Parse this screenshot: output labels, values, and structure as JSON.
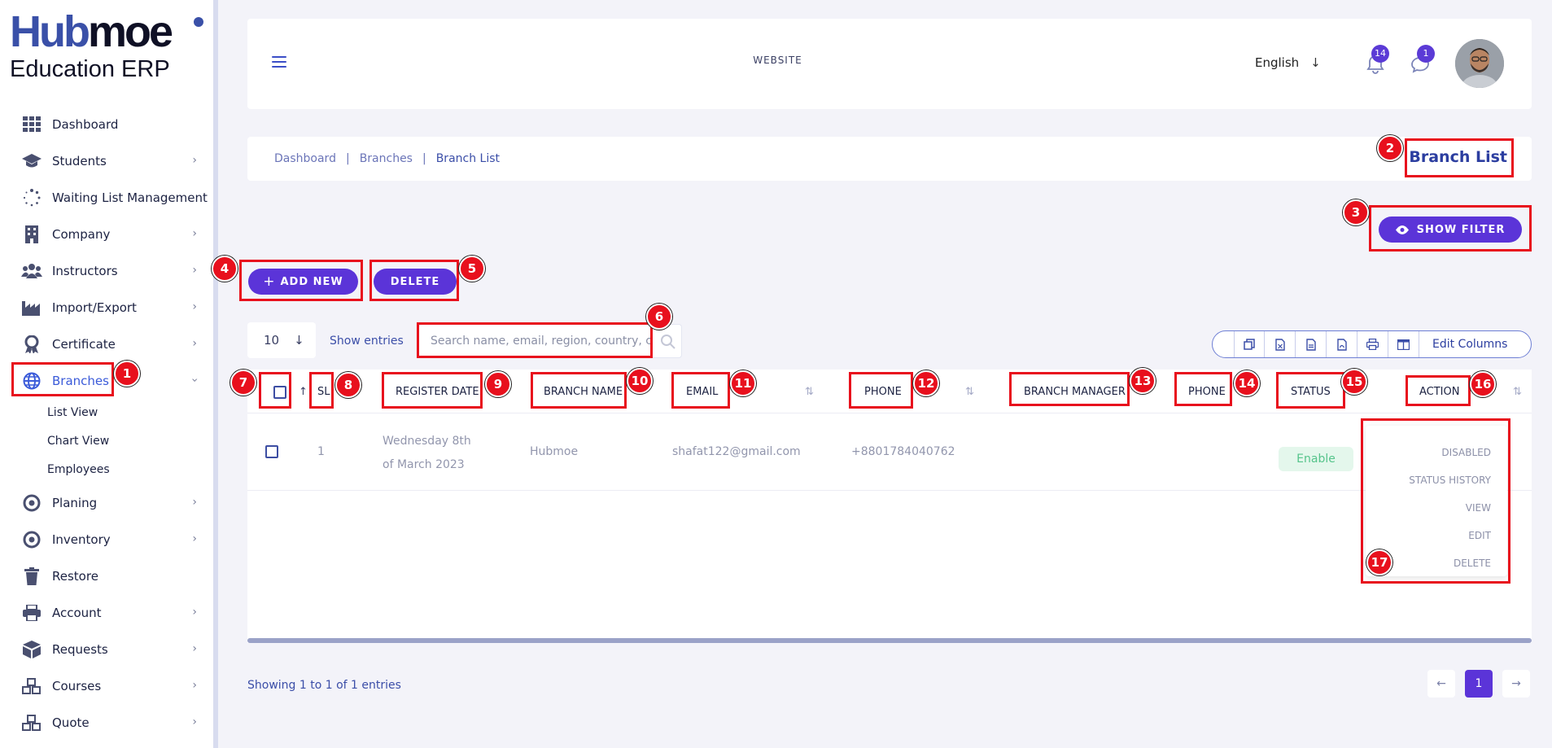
{
  "brand": {
    "logo_hub": "Hub",
    "logo_moe": "moe",
    "logo_sub": "Education ERP"
  },
  "sidebar": {
    "items": [
      {
        "label": "Dashboard",
        "icon": "grid-icon"
      },
      {
        "label": "Students",
        "icon": "graduation-cap-icon"
      },
      {
        "label": "Waiting List Management",
        "icon": "spinner-icon"
      },
      {
        "label": "Company",
        "icon": "building-icon"
      },
      {
        "label": "Instructors",
        "icon": "users-icon"
      },
      {
        "label": "Import/Export",
        "icon": "factory-icon"
      },
      {
        "label": "Certificate",
        "icon": "award-icon"
      },
      {
        "label": "Branches",
        "icon": "globe-icon"
      },
      {
        "label": "Planing",
        "icon": "target-icon"
      },
      {
        "label": "Inventory",
        "icon": "target-icon"
      },
      {
        "label": "Restore",
        "icon": "trash-icon"
      },
      {
        "label": "Account",
        "icon": "printer-icon"
      },
      {
        "label": "Requests",
        "icon": "box-icon"
      },
      {
        "label": "Courses",
        "icon": "cubes-icon"
      },
      {
        "label": "Quote",
        "icon": "cubes-icon"
      }
    ],
    "branches_sub": [
      "List View",
      "Chart View",
      "Employees"
    ]
  },
  "header": {
    "title": "WEBSITE",
    "language": "English",
    "notifications_count": "14",
    "messages_count": "1"
  },
  "breadcrumb": {
    "items": [
      "Dashboard",
      "Branches",
      "Branch List"
    ],
    "page_title": "Branch List"
  },
  "buttons": {
    "show_filter": "SHOW FILTER",
    "add_new": "ADD NEW",
    "delete": "DELETE"
  },
  "table_controls": {
    "entries_value": "10",
    "entries_label": "Show entries",
    "search_placeholder": "Search name, email, region, country, city",
    "edit_columns": "Edit Columns"
  },
  "table": {
    "headers": {
      "sl": "SL",
      "register_date": "REGISTER DATE",
      "branch_name": "BRANCH NAME",
      "email": "EMAIL",
      "phone": "PHONE",
      "branch_manager": "BRANCH MANAGER",
      "phone2": "PHONE",
      "status": "STATUS",
      "action": "ACTION"
    },
    "rows": [
      {
        "sl": "1",
        "date_line1": "Wednesday 8th",
        "date_line2": "of March 2023",
        "branch_name": "Hubmoe",
        "email": "shafat122@gmail.com",
        "phone": "+8801784040762",
        "status": "Enable"
      }
    ],
    "action_menu": [
      "DISABLED",
      "STATUS HISTORY",
      "VIEW",
      "EDIT",
      "DELETE"
    ]
  },
  "footer": {
    "showing": "Showing 1 to 1 of 1 entries",
    "page": "1"
  },
  "annotations": [
    "1",
    "2",
    "3",
    "4",
    "5",
    "6",
    "7",
    "8",
    "9",
    "10",
    "11",
    "12",
    "13",
    "14",
    "15",
    "16",
    "17"
  ],
  "colors": {
    "accent": "#5b34d8",
    "annotation": "#e8101d",
    "status_enable_bg": "#e4f7ec",
    "status_enable_text": "#56c48b"
  }
}
